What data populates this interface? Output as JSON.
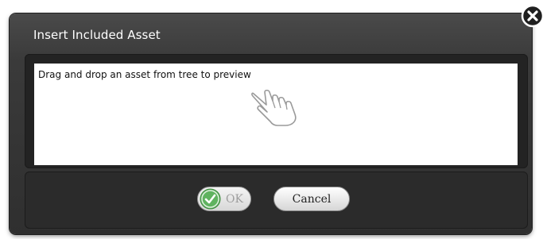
{
  "dialog": {
    "title": "Insert Included Asset",
    "preview_text": "Drag and drop an asset from tree to preview",
    "ok_label": "OK",
    "cancel_label": "Cancel",
    "ok_enabled": false
  },
  "icons": {
    "close": "close-icon",
    "drag_hand": "hand-pointer-icon",
    "ok_check": "checkmark-icon"
  },
  "colors": {
    "dialog_bg": "#3a3a3a",
    "check_green": "#4caf50"
  }
}
